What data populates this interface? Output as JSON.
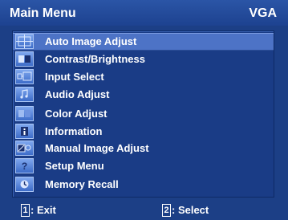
{
  "header": {
    "title": "Main Menu",
    "source": "VGA"
  },
  "menu": {
    "selected_index": 0,
    "items": [
      {
        "label": "Auto Image Adjust",
        "icon": "auto-image-adjust-icon"
      },
      {
        "label": "Contrast/Brightness",
        "icon": "contrast-brightness-icon"
      },
      {
        "label": "Input Select",
        "icon": "input-select-icon"
      },
      {
        "label": "Audio Adjust",
        "icon": "audio-adjust-icon"
      },
      {
        "label": "Color Adjust",
        "icon": "color-adjust-icon"
      },
      {
        "label": "Information",
        "icon": "information-icon"
      },
      {
        "label": "Manual Image Adjust",
        "icon": "manual-image-adjust-icon"
      },
      {
        "label": "Setup Menu",
        "icon": "setup-menu-icon"
      },
      {
        "label": "Memory Recall",
        "icon": "memory-recall-icon"
      }
    ]
  },
  "footer": {
    "exit_key": "1",
    "exit_label": ": Exit",
    "select_key": "2",
    "select_label": ": Select"
  },
  "colors": {
    "background": "#1c3f86",
    "highlight": "#4d73c6",
    "text": "#ffffff"
  }
}
